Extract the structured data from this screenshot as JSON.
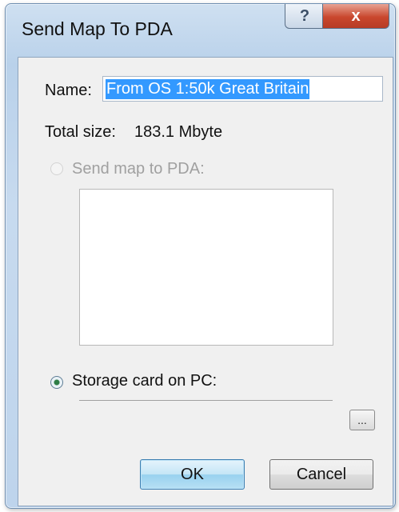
{
  "window": {
    "title": "Send Map To PDA",
    "help_glyph": "?",
    "close_glyph": "x"
  },
  "form": {
    "name_label": "Name:",
    "name_value": "From OS 1:50k Great Britain",
    "total_size_label": "Total size:",
    "total_size_value": "183.1 Mbyte",
    "send_to_pda_label": "Send map to PDA:",
    "send_to_pda_enabled": false,
    "storage_card_label": "Storage card on PC:",
    "storage_card_selected": true,
    "storage_path_value": "",
    "browse_label": "..."
  },
  "buttons": {
    "ok_label": "OK",
    "cancel_label": "Cancel"
  },
  "icons": {
    "help": "help-icon",
    "close": "close-icon"
  }
}
